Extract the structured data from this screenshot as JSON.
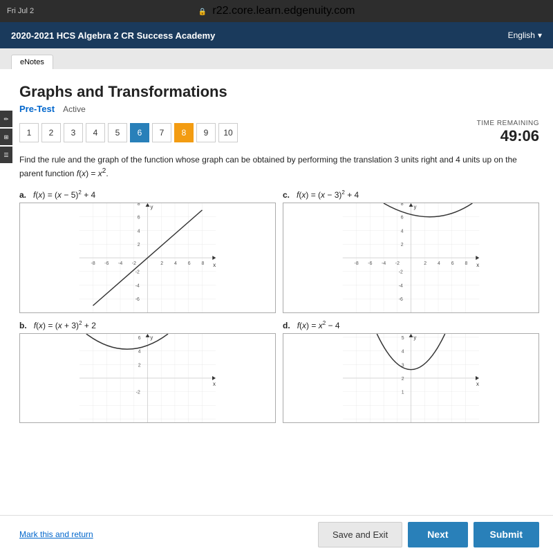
{
  "browser": {
    "time": "Fri Jul 2",
    "url": "r22.core.learn.edgenuity.com",
    "lock_icon": "🔒"
  },
  "header": {
    "title": "2020-2021 HCS Algebra 2 CR Success Academy",
    "language": "English",
    "chevron": "▾"
  },
  "tabs": {
    "enotes": "eNotes"
  },
  "page": {
    "title": "Graphs and Transformations",
    "subtitle": "Pre-Test",
    "status": "Active"
  },
  "question_nav": {
    "buttons": [
      1,
      2,
      3,
      4,
      5,
      6,
      7,
      8,
      9,
      10
    ],
    "current": 6,
    "highlighted": 8
  },
  "timer": {
    "label": "TIME REMAINING",
    "value": "49:06"
  },
  "question": {
    "text": "Find the rule and the graph of the function whose graph can be obtained by performing the translation 3 units right and 4 units up on the parent function f(x) = x².",
    "parent_function": "f(x) = x²"
  },
  "choices": {
    "a": {
      "label": "a.",
      "formula": "f(x) = (x − 5)² + 4"
    },
    "b": {
      "label": "b.",
      "formula": "f(x) = (x + 3)² + 2"
    },
    "c": {
      "label": "c.",
      "formula": "f(x) = (x − 3)² + 4"
    },
    "d": {
      "label": "d.",
      "formula": "f(x) = x² − 4"
    }
  },
  "bottom": {
    "mark_return": "Mark this and return",
    "save_exit": "Save and Exit",
    "next": "Next",
    "submit": "Submit"
  },
  "side_icons": [
    "pencil",
    "calculator",
    "notepad"
  ]
}
